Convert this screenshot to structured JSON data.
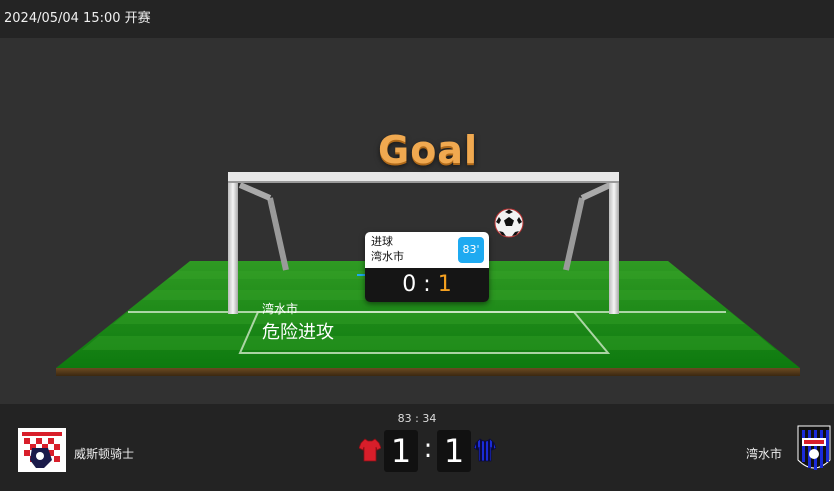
{
  "header": {
    "datetime": "2024/05/04 15:00 开赛"
  },
  "animation": {
    "title": "Goal",
    "event_card": {
      "event": "进球",
      "team": "湾水市",
      "minute": "83'",
      "score_home": "0",
      "score_sep": ":",
      "score_away": "1"
    },
    "attack": {
      "team": "湾水市",
      "label": "危险进攻"
    }
  },
  "scorebar": {
    "clock": "83 : 34",
    "home": {
      "name": "威斯顿骑士",
      "score": "1",
      "shirt_color": "#d81e2a"
    },
    "away": {
      "name": "湾水市",
      "score": "1",
      "shirt_color": "#1a2bd8"
    },
    "separator": ":"
  },
  "colors": {
    "accent": "#f4a020",
    "minute_badge": "#1eaaf1",
    "goal_title": "#f0a950"
  }
}
